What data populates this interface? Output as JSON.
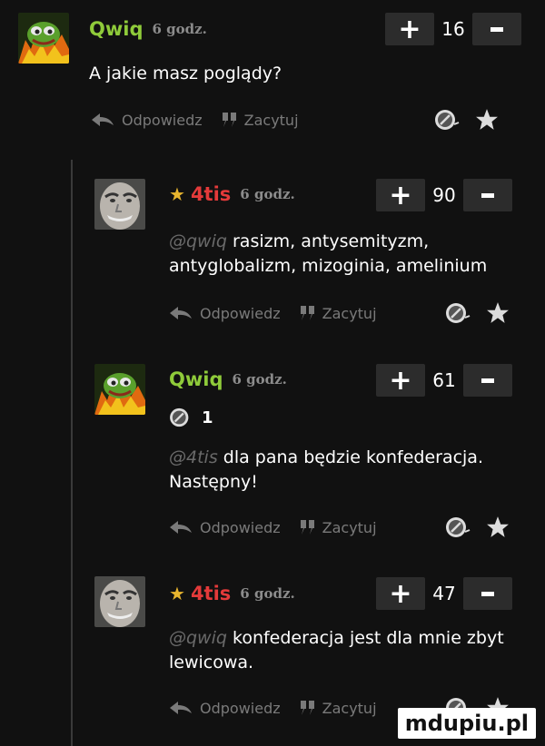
{
  "comments": [
    {
      "author": "Qwiq",
      "starred": false,
      "time": "6 godz.",
      "votes": "16",
      "mention": "",
      "text": "A jakie masz poglądy?"
    },
    {
      "author": "4tis",
      "starred": true,
      "time": "6 godz.",
      "votes": "90",
      "mention": "@qwiq",
      "text": "rasizm, antysemityzm, antyglobalizm, mizoginia, amelinium"
    },
    {
      "author": "Qwiq",
      "starred": false,
      "time": "6 godz.",
      "votes": "61",
      "reaction_count": "1",
      "mention": "@4tis",
      "text": "dla pana będzie konfederacja. Następny!"
    },
    {
      "author": "4tis",
      "starred": true,
      "time": "6 godz.",
      "votes": "47",
      "mention": "@qwiq",
      "text": "konfederacja jest dla mnie zbyt lewicowa."
    }
  ],
  "actions": {
    "reply": "Odpowiedz",
    "quote": "Zacytuj"
  },
  "icons": [
    "avatar-frog",
    "avatar-face",
    "reply-icon",
    "quote-icon",
    "reaction-icon",
    "star-icon",
    "plus-icon",
    "minus-icon"
  ],
  "colors": {
    "background": "#111111",
    "author_green": "#8fcb3a",
    "author_red": "#e43a3a",
    "star": "#e8b52e",
    "muted": "#7a7a7a",
    "vote_button": "#2c2c2c"
  },
  "watermark": "mdupiu.pl"
}
